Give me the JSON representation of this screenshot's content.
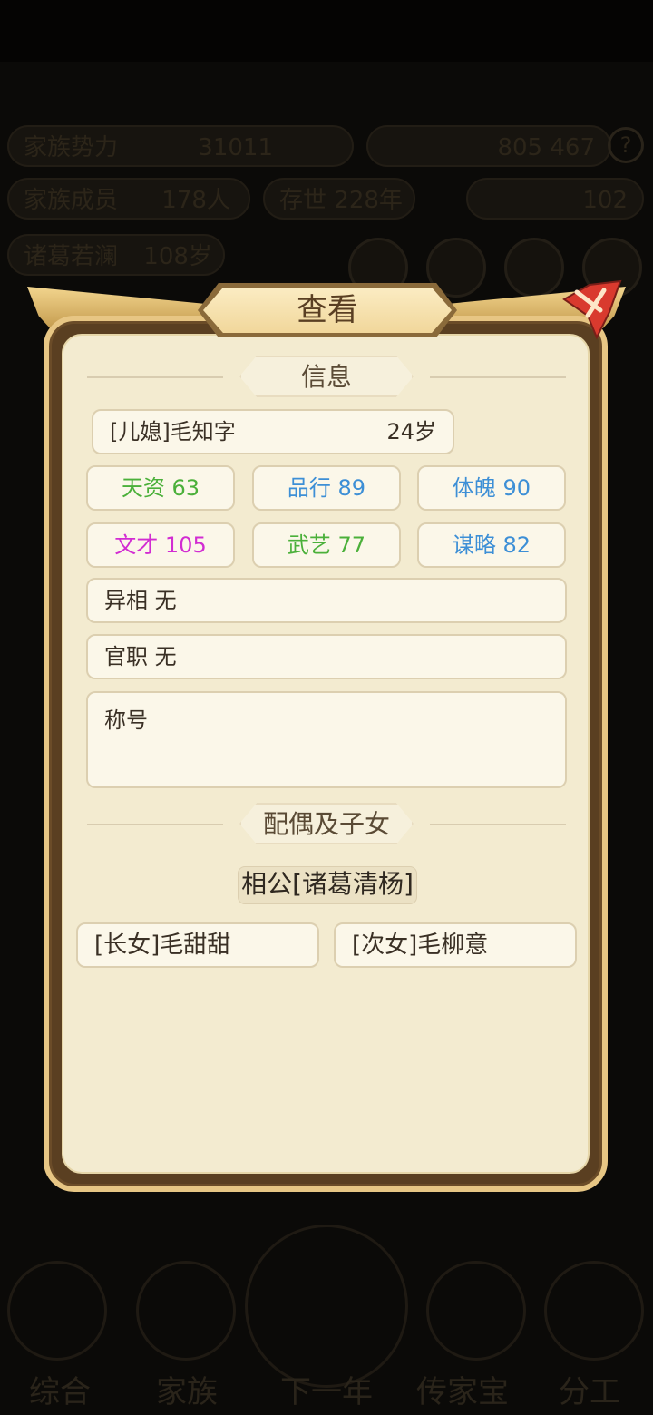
{
  "background": {
    "family_power_label": "家族势力",
    "family_power_value": "31011",
    "resource_a": "805",
    "resource_b": "467",
    "members_label": "家族成员",
    "members_value": "178人",
    "years_label": "存世",
    "years_value": "228年",
    "food_value": "102",
    "leader_name": "诸葛若澜",
    "leader_age": "108岁",
    "help_glyph": "?",
    "nav": [
      "综合",
      "家族",
      "下一年",
      "传家宝",
      "分工"
    ]
  },
  "dialog": {
    "title": "查看",
    "info_section": "信息",
    "person": {
      "name": "[儿媳]毛知字",
      "age": "24岁"
    },
    "stats": [
      {
        "label": "天资 63",
        "color": "#4bb03a"
      },
      {
        "label": "品行 89",
        "color": "#3d8fd6"
      },
      {
        "label": "体魄 90",
        "color": "#3d8fd6"
      },
      {
        "label": "文才 105",
        "color": "#d22cd2"
      },
      {
        "label": "武艺 77",
        "color": "#4bb03a"
      },
      {
        "label": "谋略 82",
        "color": "#3d8fd6"
      }
    ],
    "trait": "异相 无",
    "office": "官职 无",
    "titles_label": "称号",
    "family_section": "配偶及子女",
    "spouse": "相公[诸葛清杨]",
    "children": [
      "[长女]毛甜甜",
      "[次女]毛柳意"
    ]
  }
}
